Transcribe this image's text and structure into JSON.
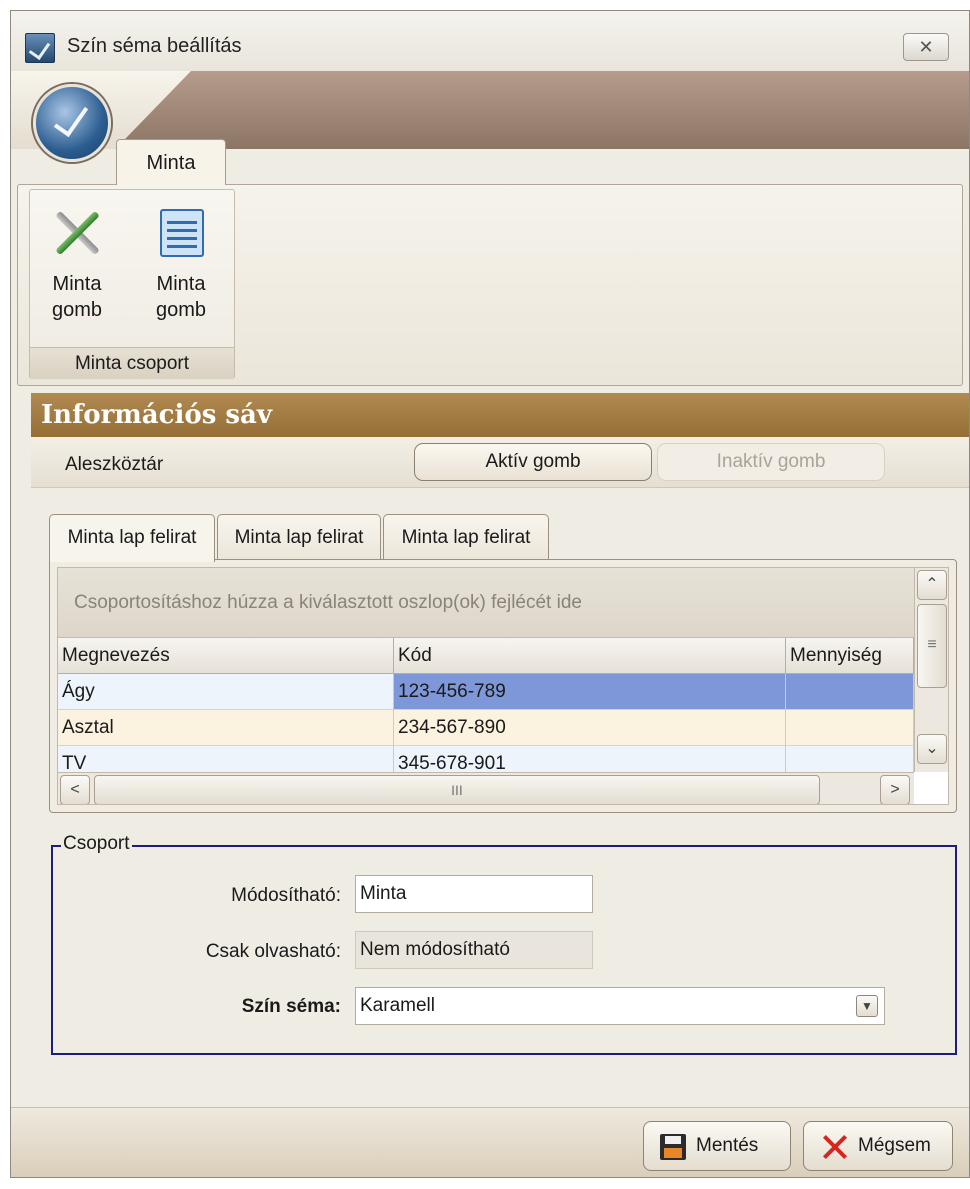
{
  "window": {
    "title": "Szín séma beállítás",
    "close_glyph": "✕"
  },
  "ribbon": {
    "tab_label": "Minta",
    "buttons": [
      {
        "label": "Minta gomb",
        "icon": "tools-icon"
      },
      {
        "label": "Minta gomb",
        "icon": "document-list-icon"
      }
    ],
    "group_label": "Minta csoport"
  },
  "info_bar": {
    "title": "Információs sáv"
  },
  "subtoolbar": {
    "label": "Aleszköztár",
    "active_button": "Aktív gomb",
    "inactive_button": "Inaktív gomb"
  },
  "tabs": [
    "Minta lap felirat",
    "Minta lap felirat",
    "Minta lap felirat"
  ],
  "grid": {
    "group_hint": "Csoportosításhoz húzza a kiválasztott oszlop(ok) fejlécét ide",
    "columns": [
      "Megnevezés",
      "Kód",
      "Mennyiség"
    ],
    "rows": [
      [
        "Ágy",
        "123-456-789",
        ""
      ],
      [
        "Asztal",
        "234-567-890",
        ""
      ],
      [
        "TV",
        "345-678-901",
        ""
      ]
    ],
    "scroll_glyphs": {
      "up": "⌃",
      "down": "⌄",
      "left": "<",
      "right": ">",
      "vgrip": "≡",
      "hgrip": "III"
    }
  },
  "group": {
    "legend": "Csoport",
    "editable_label": "Módosítható:",
    "editable_value": "Minta",
    "readonly_label": "Csak olvasható:",
    "readonly_value": "Nem módosítható",
    "scheme_label": "Szín séma:",
    "scheme_value": "Karamell"
  },
  "footer": {
    "save_label": "Mentés",
    "cancel_label": "Mégsem"
  },
  "colors": {
    "info_bar": "#a17d45",
    "selected_cell": "#7e97d9",
    "alt_row": "#fbf2e0",
    "fieldset_border": "#1c1e7a"
  }
}
